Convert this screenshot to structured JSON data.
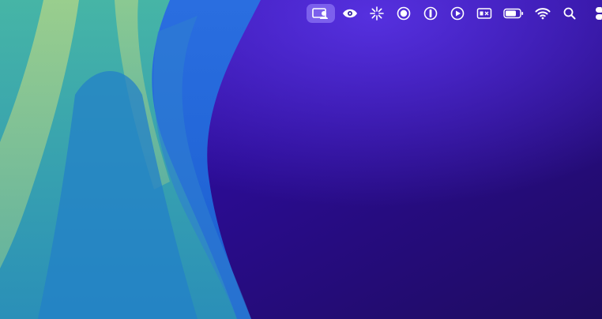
{
  "desktop": {
    "wallpaper_colors": {
      "violet_dark": "#1e0c5e",
      "violet_mid": "#3410a4",
      "violet_light": "#4d26d4",
      "blue": "#1b5fd0",
      "teal": "#3aa6a4",
      "green": "#9ccd84"
    }
  },
  "menubar": {
    "items": [
      {
        "icon": "screen-sharing-icon",
        "active": true
      },
      {
        "icon": "eye-icon"
      },
      {
        "icon": "sparkle-burst-icon"
      },
      {
        "icon": "circle-record-icon"
      },
      {
        "icon": "password-manager-icon"
      },
      {
        "icon": "play-circle-icon"
      },
      {
        "icon": "keyboard-input-icon"
      },
      {
        "icon": "battery-icon"
      },
      {
        "icon": "wifi-icon"
      },
      {
        "icon": "search-icon"
      },
      {
        "icon": "control-center-icon"
      }
    ],
    "highlight_color": "#9b8cff"
  }
}
